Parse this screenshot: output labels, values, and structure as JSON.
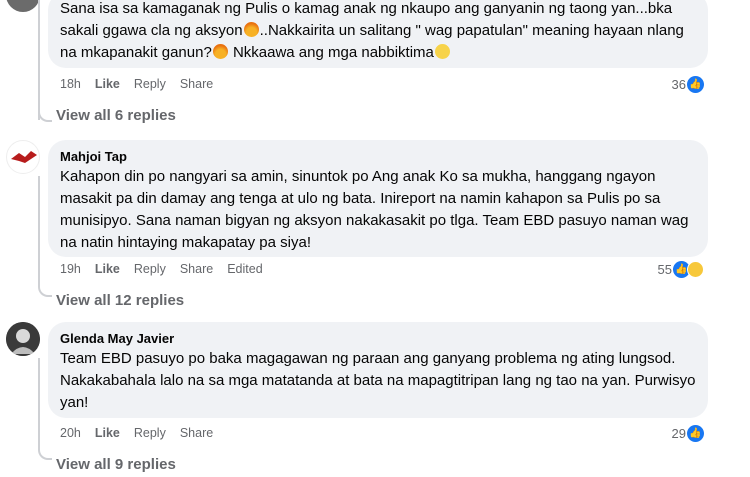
{
  "comments": [
    {
      "author": "",
      "text_parts": [
        "Sana isa sa kamaganak ng Pulis o kamag anak ng nkaupo ang ganyanin ng taong yan...bka sakali ggawa cla ng aksyon",
        "..Nakkairita un salitang \" wag papatulan\" meaning hayaan nlang na mkapanakit ganun?",
        " Nkkaawa ang mga nabbiktima"
      ],
      "time": "18h",
      "like_label": "Like",
      "reply_label": "Reply",
      "share_label": "Share",
      "reaction_count": "36",
      "view_replies": "View all 6 replies"
    },
    {
      "author": "Mahjoi Tap",
      "text": "Kahapon din po nangyari sa amin, sinuntok po Ang anak Ko sa mukha, hanggang ngayon masakit pa din damay ang tenga at ulo ng bata. Inireport na namin kahapon sa Pulis po sa munisipyo. Sana naman bigyan ng aksyon nakakasakit po tlga. Team EBD pasuyo naman wag na natin hintaying makapatay pa siya!",
      "time": "19h",
      "like_label": "Like",
      "reply_label": "Reply",
      "share_label": "Share",
      "edited_label": "Edited",
      "reaction_count": "55",
      "view_replies": "View all 12 replies"
    },
    {
      "author": "Glenda May Javier",
      "text": "Team EBD pasuyo po baka magagawan ng paraan ang ganyang problema ng ating lungsod. Nakakabahala lalo na sa mga matatanda at bata na mapagtitripan lang ng tao na yan. Purwisyo yan!",
      "time": "20h",
      "like_label": "Like",
      "reply_label": "Reply",
      "share_label": "Share",
      "reaction_count": "29",
      "view_replies": "View all 9 replies"
    }
  ],
  "colors": {
    "bubble": "#f0f2f5",
    "meta": "#65676b",
    "like": "#1877f2"
  },
  "icons": [
    "angry-emoji-icon",
    "sad-emoji-icon",
    "like-reaction-icon",
    "sad-reaction-icon"
  ]
}
